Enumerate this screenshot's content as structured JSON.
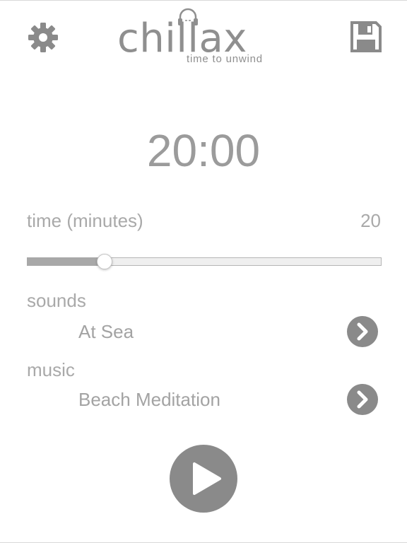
{
  "header": {
    "logo_word": "chillax",
    "logo_tagline": "time to unwind",
    "left_icon": "gear-icon",
    "right_icon": "floppy-disk-icon"
  },
  "timer": {
    "display": "20:00"
  },
  "time_setting": {
    "label": "time (minutes)",
    "value": "20",
    "slider_fraction": 0.22
  },
  "sounds": {
    "label": "sounds",
    "selected": "At Sea",
    "icon": "chevron-right-circle-icon"
  },
  "music": {
    "label": "music",
    "selected": "Beach Meditation",
    "icon": "chevron-right-circle-icon"
  },
  "controls": {
    "play_icon": "play-icon"
  },
  "colors": {
    "icon_gray": "#8a8a8a",
    "text_gray": "#a5a5a5",
    "slider_fill": "#a8a8a8",
    "slider_track": "#efefef"
  }
}
